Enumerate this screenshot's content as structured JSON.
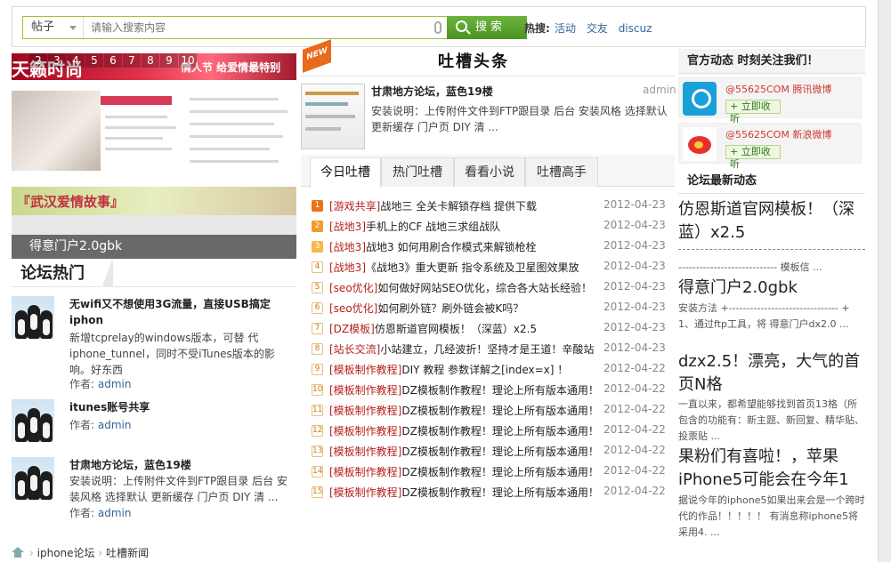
{
  "search": {
    "scope": "帖子",
    "placeholder": "请输入搜索内容",
    "button": "搜索",
    "hot_label": "热搜:",
    "hot_links": [
      "活动",
      "交友",
      "discuz"
    ]
  },
  "slideshow": {
    "numbers": [
      "2",
      "3",
      "4",
      "5",
      "6",
      "7",
      "8",
      "9",
      "10"
    ],
    "brand": "天籁时尚",
    "brand_sub": "情人节 给爱情最特别",
    "lower_tag": "『武汉爱情故事』",
    "caption": "得意门户2.0gbk"
  },
  "forum_hot": {
    "title": "论坛热门",
    "items": [
      {
        "title": "无wifi又不想使用3G流量，直接USB搞定iphon",
        "desc": "新增tcprelay的windows版本，可替 代iphone_tunnel，同时不受iTunes版本的影响。好东西",
        "author_label": "作者:",
        "author": "admin"
      },
      {
        "title": "itunes账号共享",
        "desc": "",
        "author_label": "作者:",
        "author": "admin"
      },
      {
        "title": "甘肃地方论坛，蓝色19楼",
        "desc": "安装说明：上传附件文件到FTP跟目录 后台 安装风格 选择默认 更新缓存 门户页 DIY 清 ...",
        "author_label": "作者:",
        "author": "admin"
      }
    ]
  },
  "center": {
    "ribbon": "NEW",
    "heading": "吐槽头条",
    "news_title": "甘肃地方论坛，蓝色19楼",
    "news_author": "admin",
    "news_desc": "安装说明：上传附件文件到FTP跟目录 后台 安装风格 选择默认 更新缓存 门户页 DIY 清 ...",
    "tabs": [
      "今日吐槽",
      "热门吐槽",
      "看看小说",
      "吐槽高手"
    ],
    "list": [
      {
        "n": "1",
        "cat": "[游戏共享]",
        "text": "战地三 全关卡解锁存档 提供下载",
        "date": "2012-04-23"
      },
      {
        "n": "2",
        "cat": "[战地3]",
        "text": "手机上的CF 战地三求组战队",
        "date": "2012-04-23"
      },
      {
        "n": "3",
        "cat": "[战地3]",
        "text": "战地3 如何用刷合作模式来解锁枪栓",
        "date": "2012-04-23"
      },
      {
        "n": "4",
        "cat": "[战地3]",
        "text": "《战地3》重大更新 指令系统及卫星图效果放",
        "date": "2012-04-23"
      },
      {
        "n": "5",
        "cat": "[seo优化]",
        "text": "如何做好网站SEO优化，综合各大站长经验！",
        "date": "2012-04-23"
      },
      {
        "n": "6",
        "cat": "[seo优化]",
        "text": "如何刷外链？刷外链会被K吗？",
        "date": "2012-04-23"
      },
      {
        "n": "7",
        "cat": "[DZ模板]",
        "text": "仿恩斯道官网模板！（深蓝）x2.5",
        "date": "2012-04-23"
      },
      {
        "n": "8",
        "cat": "[站长交流]",
        "text": "小站建立，几经波折！坚持才是王道！辛酸站",
        "date": "2012-04-23"
      },
      {
        "n": "9",
        "cat": "[模板制作教程]",
        "text": "DIY 教程 参数详解之[index=x] ！",
        "date": "2012-04-22"
      },
      {
        "n": "10",
        "cat": "[模板制作教程]",
        "text": "DZ模板制作教程！理论上所有版本通用！",
        "date": "2012-04-22"
      },
      {
        "n": "11",
        "cat": "[模板制作教程]",
        "text": "DZ模板制作教程！理论上所有版本通用！",
        "date": "2012-04-22"
      },
      {
        "n": "12",
        "cat": "[模板制作教程]",
        "text": "DZ模板制作教程！理论上所有版本通用！",
        "date": "2012-04-22"
      },
      {
        "n": "13",
        "cat": "[模板制作教程]",
        "text": "DZ模板制作教程！理论上所有版本通用！",
        "date": "2012-04-22"
      },
      {
        "n": "14",
        "cat": "[模板制作教程]",
        "text": "DZ模板制作教程！理论上所有版本通用！",
        "date": "2012-04-22"
      },
      {
        "n": "15",
        "cat": "[模板制作教程]",
        "text": "DZ模板制作教程！理论上所有版本通用！",
        "date": "2012-04-22"
      }
    ]
  },
  "right": {
    "official_title": "官方动态 时刻关注我们！",
    "weibo": [
      {
        "name": "@55625COM 腾讯微博",
        "follow": "+ 立即收听"
      },
      {
        "name": "@55625COM 新浪微博",
        "follow": "+ 立即收听"
      }
    ],
    "latest_title": "论坛最新动态",
    "news": [
      {
        "title": "仿恩斯道官网模板！（深蓝）x2.5",
        "desc": "---------------------------- 模板信 ..."
      },
      {
        "title": "得意门户2.0gbk",
        "desc": "安装方法 +------------------------------- + 1、通过ftp工具，将 得意门户dx2.0 ..."
      },
      {
        "title": "dzx2.5！漂亮，大气的首页N格",
        "desc": "一直以来，都希望能够找到首页13格（所包含的功能有：新主题、新回复、精华贴、投票贴 ..."
      },
      {
        "title": "果粉们有喜啦！，苹果iPhone5可能会在今年1",
        "desc": "据说今年的iphone5如果出来会是一个跨时代的作品！！！！！ 有消息称iphone5将采用4. ..."
      }
    ]
  },
  "breadcrumb": [
    "iphone论坛",
    "吐槽新闻"
  ]
}
